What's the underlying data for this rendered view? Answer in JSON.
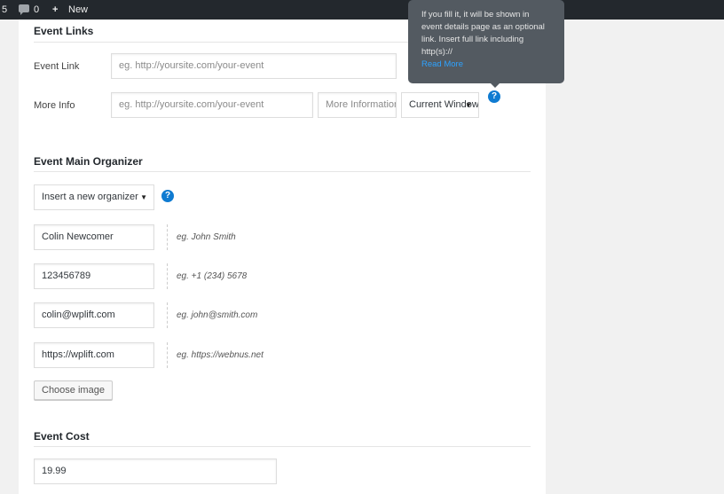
{
  "adminbar": {
    "num": "5",
    "comment_count": "0",
    "plus": "+",
    "new_label": "New"
  },
  "links": {
    "title": "Event Links",
    "event_link_label": "Event Link",
    "event_link_placeholder": "eg. http://yoursite.com/your-event",
    "more_info_label": "More Info",
    "more_info_placeholder": "eg. http://yoursite.com/your-event",
    "more_info_title_placeholder": "More Information",
    "target_select": "Current Window"
  },
  "tooltip": {
    "text": "If you fill it, it will be shown in event details page as an optional link. Insert full link including http(s)://",
    "read_more": "Read More"
  },
  "organizer": {
    "title": "Event Main Organizer",
    "select": "Insert a new organizer",
    "name": "Colin Newcomer",
    "name_hint": "eg. John Smith",
    "phone": "123456789",
    "phone_hint": "eg. +1 (234) 5678",
    "email": "colin@wplift.com",
    "email_hint": "eg. john@smith.com",
    "website": "https://wplift.com",
    "website_hint": "eg. https://webnus.net",
    "choose_image": "Choose image"
  },
  "cost": {
    "title": "Event Cost",
    "value": "19.99"
  },
  "icons": {
    "help": "?",
    "dropdown_arrow": "▼"
  },
  "colors": {
    "adminbar": "#23282d",
    "help_icon": "#0f7bd1",
    "tooltip_bg": "#535a61",
    "read_more": "#2ea2ff"
  }
}
